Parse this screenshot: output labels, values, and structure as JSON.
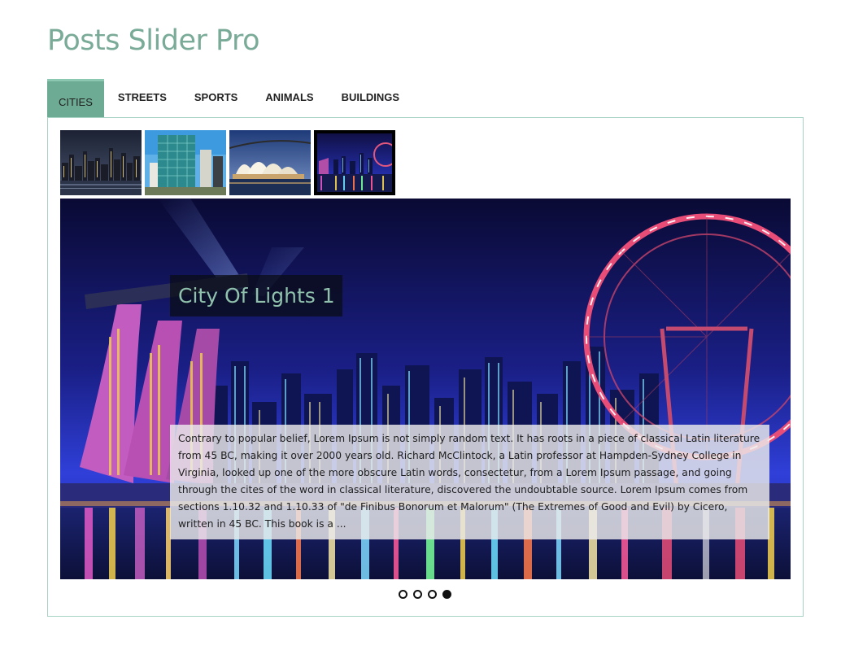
{
  "page": {
    "title": "Posts Slider Pro"
  },
  "tabs": [
    {
      "label": "CITIES",
      "active": true
    },
    {
      "label": "STREETS",
      "active": false
    },
    {
      "label": "SPORTS",
      "active": false
    },
    {
      "label": "ANIMALS",
      "active": false
    },
    {
      "label": "BUILDINGS",
      "active": false
    }
  ],
  "thumbnails": [
    {
      "subject": "city skyline at night",
      "selected": false
    },
    {
      "subject": "glass office tower",
      "selected": false
    },
    {
      "subject": "opera house at harbour",
      "selected": false
    },
    {
      "subject": "city of lights at night",
      "selected": true
    }
  ],
  "slide": {
    "title": "City Of Lights 1",
    "excerpt": "Contrary to popular belief, Lorem Ipsum is not simply random text. It has roots in a piece of classical Latin literature from 45 BC, making it over 2000 years old. Richard McClintock, a Latin professor at Hampden-Sydney College in Virginia, looked up one of the more obscure Latin words, consectetur, from a Lorem Ipsum passage, and going through the cites of the word in classical literature, discovered the undoubtable source. Lorem Ipsum comes from sections 1.10.32 and 1.10.33 of \"de Finibus Bonorum et Malorum\" (The Extremes of Good and Evil) by Cicero, written in 45 BC. This book is a ..."
  },
  "pager": {
    "total": 4,
    "active_index": 4
  },
  "colors": {
    "accent": "#6dab95",
    "title": "#7aab98",
    "panel_border": "#a6d3c3"
  }
}
